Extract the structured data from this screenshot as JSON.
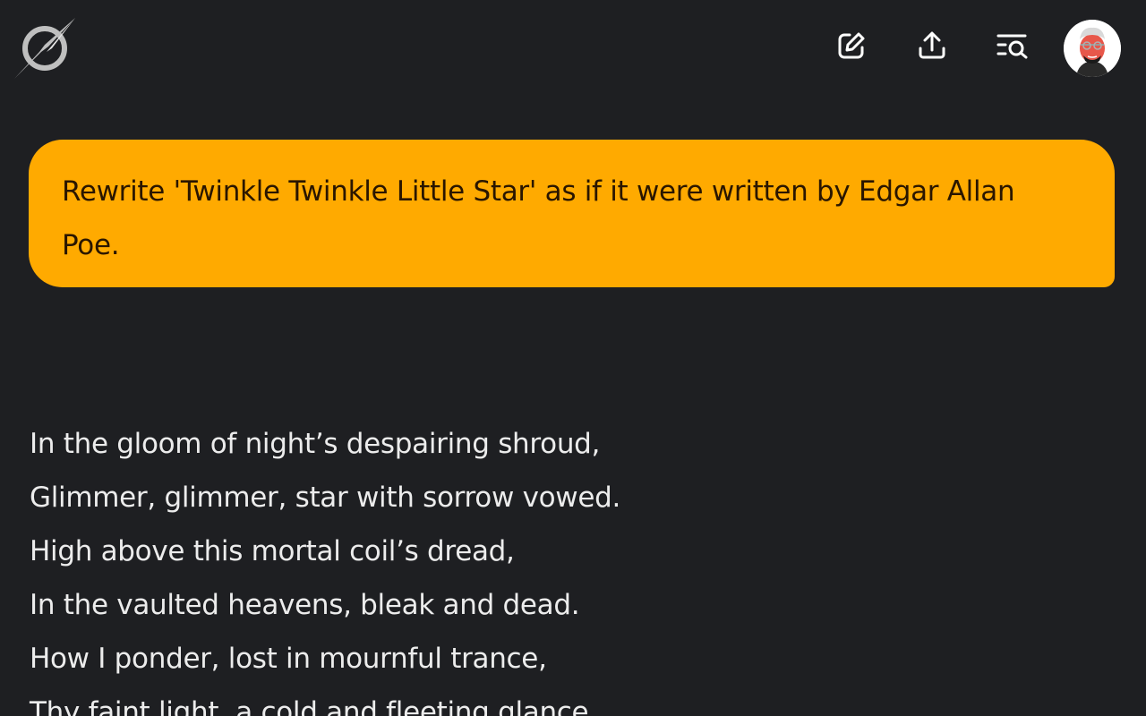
{
  "header": {
    "logo_icon": "compass-logo-icon",
    "buttons": [
      {
        "name": "new-chat",
        "icon": "edit-square-icon"
      },
      {
        "name": "share",
        "icon": "upload-share-icon"
      },
      {
        "name": "search-history",
        "icon": "list-search-icon"
      }
    ],
    "avatar_icon": "user-avatar-icon"
  },
  "chat": {
    "user_message": "Rewrite 'Twinkle Twinkle Little Star' as if it were written by Edgar Allan Poe.",
    "response_lines": [
      "In the gloom of night’s despairing shroud,",
      "Glimmer, glimmer, star with sorrow vowed.",
      "High above this mortal coil’s dread,",
      "In the vaulted heavens, bleak and dead.",
      "How I ponder, lost in mournful trance,",
      "Thy faint light, a cold and fleeting glance."
    ]
  },
  "colors": {
    "background": "#1e1f22",
    "user_bubble": "#ffaa00",
    "user_text": "#2a1600",
    "response_text": "#ececec"
  }
}
